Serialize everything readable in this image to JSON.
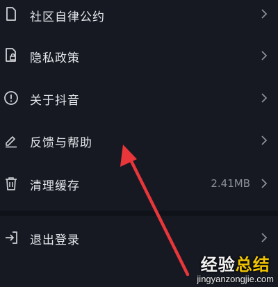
{
  "menu": {
    "items": [
      {
        "label": "社区自律公约",
        "icon": "document-icon"
      },
      {
        "label": "隐私政策",
        "icon": "privacy-lock-icon"
      },
      {
        "label": "关于抖音",
        "icon": "info-icon"
      },
      {
        "label": "反馈与帮助",
        "icon": "pencil-icon"
      },
      {
        "label": "清理缓存",
        "icon": "trash-icon",
        "value": "2.41MB"
      },
      {
        "label": "退出登录",
        "icon": "logout-icon"
      }
    ]
  },
  "annotation": {
    "arrow_color": "#e8363a"
  },
  "watermark": {
    "title_part1": "经验",
    "title_part2": "总结",
    "url": "jingyanzongjie.com"
  },
  "colors": {
    "background": "#161922",
    "text": "#e4e6ea",
    "secondary_text": "#8b8f97",
    "icon": "#d0d2d6"
  }
}
